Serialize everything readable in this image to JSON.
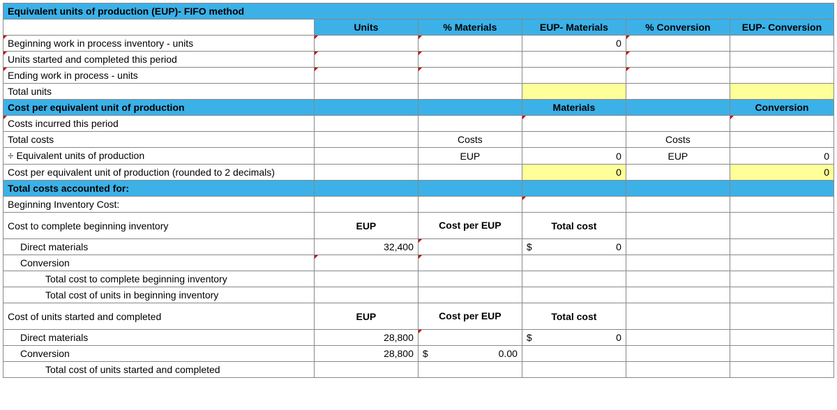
{
  "title": "Equivalent units of production (EUP)- FIFO method",
  "headers": {
    "units": "Units",
    "pct_materials": "% Materials",
    "eup_materials": "EUP- Materials",
    "pct_conversion": "% Conversion",
    "eup_conversion": "EUP- Conversion"
  },
  "rows": {
    "beg_wip": "Beginning work in process inventory - units",
    "started_completed": "Units started and completed this period",
    "end_wip": "Ending work in process - units",
    "total_units": "Total units",
    "cost_per_eup_hdr": "Cost per equivalent unit of production",
    "materials_hdr": "Materials",
    "conversion_hdr": "Conversion",
    "costs_incurred": "Costs incurred this period",
    "total_costs": "Total costs",
    "div_eup": "Equivalent units of production",
    "cost_per_eup_round": "Cost per equivalent unit of production (rounded to 2 decimals)",
    "total_costs_acct": "Total costs accounted for:",
    "beg_inv_cost": "Beginning Inventory Cost:",
    "cost_complete_beg": "Cost to complete beginning inventory",
    "direct_materials": "Direct materials",
    "conversion": "Conversion",
    "total_complete_beg": "Total cost to complete beginning inventory",
    "total_beg_inv": "Total cost of units in beginning inventory",
    "cost_started_completed": "Cost of units started and completed",
    "total_started_completed": "Total cost of units started and completed"
  },
  "labels": {
    "costs": "Costs",
    "eup": "EUP",
    "cost_per_eup": "Cost per EUP",
    "total_cost": "Total cost"
  },
  "values": {
    "zero": "0",
    "dm_eup_beg": "32,400",
    "dm_eup_sc": "28,800",
    "conv_eup_sc": "28,800",
    "dollar": "$",
    "conv_cpe_sc": "0.00"
  },
  "sym": {
    "div": "÷"
  }
}
